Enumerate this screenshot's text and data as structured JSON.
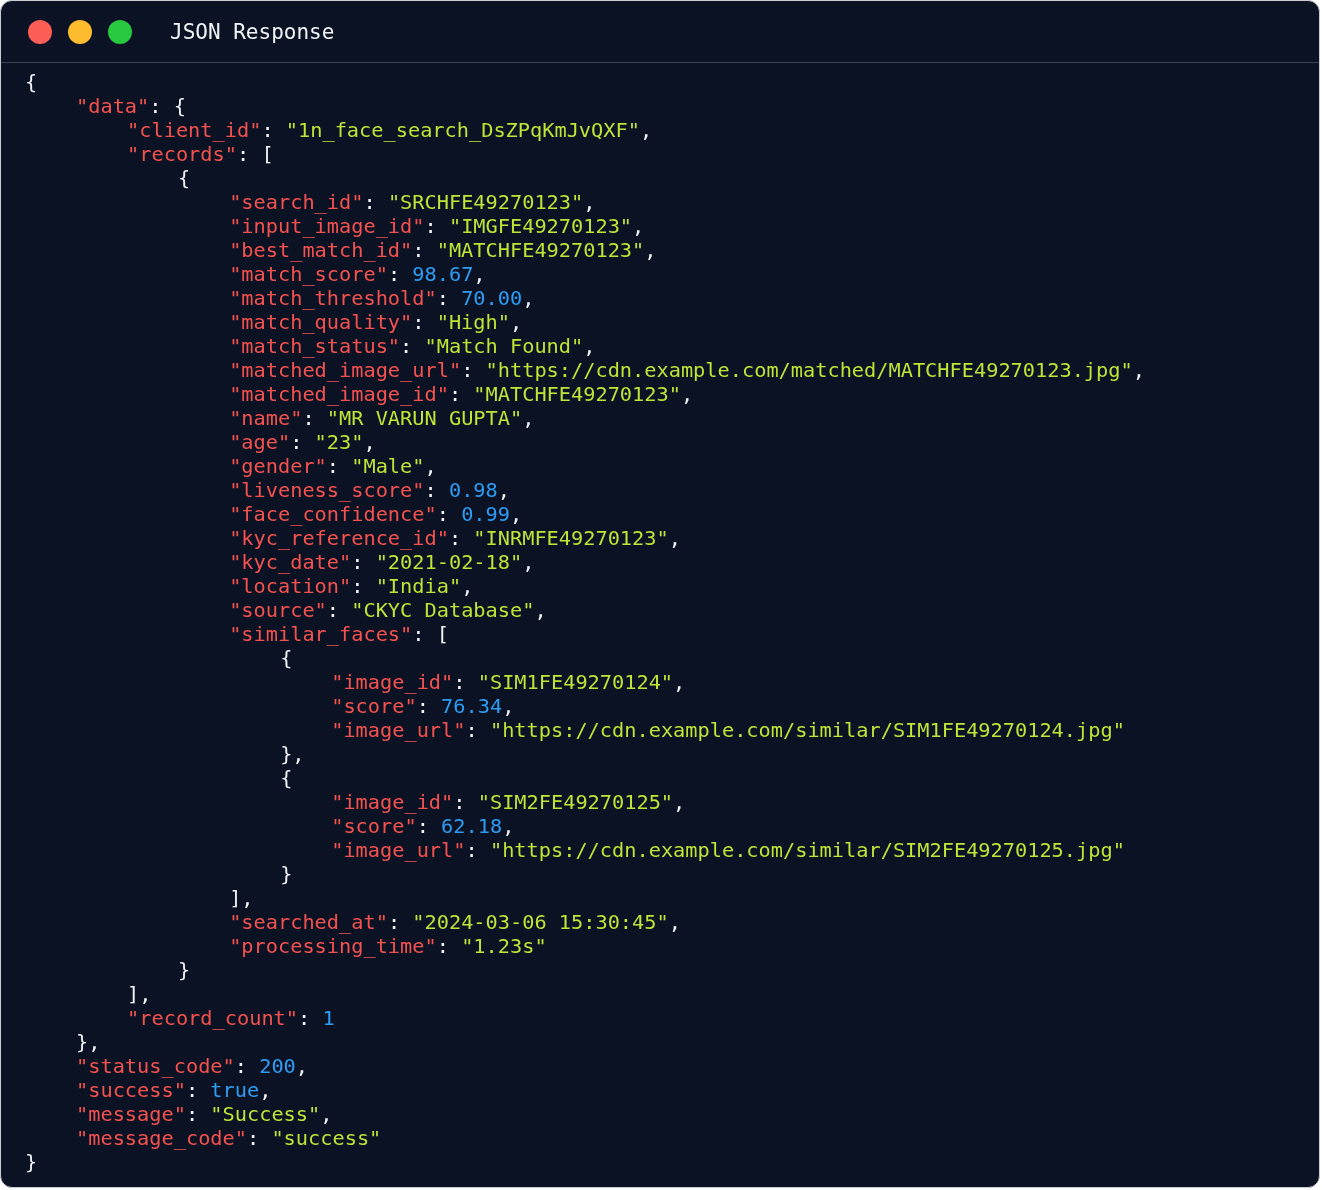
{
  "window": {
    "title": "JSON Response"
  },
  "code": [
    {
      "tokens": [
        {
          "kind": "punct",
          "text": "{"
        }
      ],
      "children": [
        {
          "tokens": [
            {
              "kind": "key",
              "text": "\"data\""
            },
            {
              "kind": "punct",
              "text": ": {"
            }
          ],
          "children": [
            {
              "tokens": [
                {
                  "kind": "key",
                  "text": "\"client_id\""
                },
                {
                  "kind": "punct",
                  "text": ": "
                },
                {
                  "kind": "string",
                  "text": "\"1n_face_search_DsZPqKmJvQXF\""
                },
                {
                  "kind": "punct",
                  "text": ","
                }
              ]
            },
            {
              "tokens": [
                {
                  "kind": "key",
                  "text": "\"records\""
                },
                {
                  "kind": "punct",
                  "text": ": ["
                }
              ],
              "children": [
                {
                  "tokens": [
                    {
                      "kind": "punct",
                      "text": "{"
                    }
                  ],
                  "children": [
                    {
                      "tokens": [
                        {
                          "kind": "key",
                          "text": "\"search_id\""
                        },
                        {
                          "kind": "punct",
                          "text": ": "
                        },
                        {
                          "kind": "string",
                          "text": "\"SRCHFE49270123\""
                        },
                        {
                          "kind": "punct",
                          "text": ","
                        }
                      ]
                    },
                    {
                      "tokens": [
                        {
                          "kind": "key",
                          "text": "\"input_image_id\""
                        },
                        {
                          "kind": "punct",
                          "text": ": "
                        },
                        {
                          "kind": "string",
                          "text": "\"IMGFE49270123\""
                        },
                        {
                          "kind": "punct",
                          "text": ","
                        }
                      ]
                    },
                    {
                      "tokens": [
                        {
                          "kind": "key",
                          "text": "\"best_match_id\""
                        },
                        {
                          "kind": "punct",
                          "text": ": "
                        },
                        {
                          "kind": "string",
                          "text": "\"MATCHFE49270123\""
                        },
                        {
                          "kind": "punct",
                          "text": ","
                        }
                      ]
                    },
                    {
                      "tokens": [
                        {
                          "kind": "key",
                          "text": "\"match_score\""
                        },
                        {
                          "kind": "punct",
                          "text": ": "
                        },
                        {
                          "kind": "number",
                          "text": "98.67"
                        },
                        {
                          "kind": "punct",
                          "text": ","
                        }
                      ]
                    },
                    {
                      "tokens": [
                        {
                          "kind": "key",
                          "text": "\"match_threshold\""
                        },
                        {
                          "kind": "punct",
                          "text": ": "
                        },
                        {
                          "kind": "number",
                          "text": "70.00"
                        },
                        {
                          "kind": "punct",
                          "text": ","
                        }
                      ]
                    },
                    {
                      "tokens": [
                        {
                          "kind": "key",
                          "text": "\"match_quality\""
                        },
                        {
                          "kind": "punct",
                          "text": ": "
                        },
                        {
                          "kind": "string",
                          "text": "\"High\""
                        },
                        {
                          "kind": "punct",
                          "text": ","
                        }
                      ]
                    },
                    {
                      "tokens": [
                        {
                          "kind": "key",
                          "text": "\"match_status\""
                        },
                        {
                          "kind": "punct",
                          "text": ": "
                        },
                        {
                          "kind": "string",
                          "text": "\"Match Found\""
                        },
                        {
                          "kind": "punct",
                          "text": ","
                        }
                      ]
                    },
                    {
                      "tokens": [
                        {
                          "kind": "key",
                          "text": "\"matched_image_url\""
                        },
                        {
                          "kind": "punct",
                          "text": ": "
                        },
                        {
                          "kind": "string",
                          "text": "\"https://cdn.example.com/matched/MATCHFE49270123.jpg\""
                        },
                        {
                          "kind": "punct",
                          "text": ","
                        }
                      ]
                    },
                    {
                      "tokens": [
                        {
                          "kind": "key",
                          "text": "\"matched_image_id\""
                        },
                        {
                          "kind": "punct",
                          "text": ": "
                        },
                        {
                          "kind": "string",
                          "text": "\"MATCHFE49270123\""
                        },
                        {
                          "kind": "punct",
                          "text": ","
                        }
                      ]
                    },
                    {
                      "tokens": [
                        {
                          "kind": "key",
                          "text": "\"name\""
                        },
                        {
                          "kind": "punct",
                          "text": ": "
                        },
                        {
                          "kind": "string",
                          "text": "\"MR VARUN GUPTA\""
                        },
                        {
                          "kind": "punct",
                          "text": ","
                        }
                      ]
                    },
                    {
                      "tokens": [
                        {
                          "kind": "key",
                          "text": "\"age\""
                        },
                        {
                          "kind": "punct",
                          "text": ": "
                        },
                        {
                          "kind": "string",
                          "text": "\"23\""
                        },
                        {
                          "kind": "punct",
                          "text": ","
                        }
                      ]
                    },
                    {
                      "tokens": [
                        {
                          "kind": "key",
                          "text": "\"gender\""
                        },
                        {
                          "kind": "punct",
                          "text": ": "
                        },
                        {
                          "kind": "string",
                          "text": "\"Male\""
                        },
                        {
                          "kind": "punct",
                          "text": ","
                        }
                      ]
                    },
                    {
                      "tokens": [
                        {
                          "kind": "key",
                          "text": "\"liveness_score\""
                        },
                        {
                          "kind": "punct",
                          "text": ": "
                        },
                        {
                          "kind": "number",
                          "text": "0.98"
                        },
                        {
                          "kind": "punct",
                          "text": ","
                        }
                      ]
                    },
                    {
                      "tokens": [
                        {
                          "kind": "key",
                          "text": "\"face_confidence\""
                        },
                        {
                          "kind": "punct",
                          "text": ": "
                        },
                        {
                          "kind": "number",
                          "text": "0.99"
                        },
                        {
                          "kind": "punct",
                          "text": ","
                        }
                      ]
                    },
                    {
                      "tokens": [
                        {
                          "kind": "key",
                          "text": "\"kyc_reference_id\""
                        },
                        {
                          "kind": "punct",
                          "text": ": "
                        },
                        {
                          "kind": "string",
                          "text": "\"INRMFE49270123\""
                        },
                        {
                          "kind": "punct",
                          "text": ","
                        }
                      ]
                    },
                    {
                      "tokens": [
                        {
                          "kind": "key",
                          "text": "\"kyc_date\""
                        },
                        {
                          "kind": "punct",
                          "text": ": "
                        },
                        {
                          "kind": "string",
                          "text": "\"2021-02-18\""
                        },
                        {
                          "kind": "punct",
                          "text": ","
                        }
                      ]
                    },
                    {
                      "tokens": [
                        {
                          "kind": "key",
                          "text": "\"location\""
                        },
                        {
                          "kind": "punct",
                          "text": ": "
                        },
                        {
                          "kind": "string",
                          "text": "\"India\""
                        },
                        {
                          "kind": "punct",
                          "text": ","
                        }
                      ]
                    },
                    {
                      "tokens": [
                        {
                          "kind": "key",
                          "text": "\"source\""
                        },
                        {
                          "kind": "punct",
                          "text": ": "
                        },
                        {
                          "kind": "string",
                          "text": "\"CKYC Database\""
                        },
                        {
                          "kind": "punct",
                          "text": ","
                        }
                      ]
                    },
                    {
                      "tokens": [
                        {
                          "kind": "key",
                          "text": "\"similar_faces\""
                        },
                        {
                          "kind": "punct",
                          "text": ": ["
                        }
                      ],
                      "children": [
                        {
                          "tokens": [
                            {
                              "kind": "punct",
                              "text": "{"
                            }
                          ],
                          "children": [
                            {
                              "tokens": [
                                {
                                  "kind": "key",
                                  "text": "\"image_id\""
                                },
                                {
                                  "kind": "punct",
                                  "text": ": "
                                },
                                {
                                  "kind": "string",
                                  "text": "\"SIM1FE49270124\""
                                },
                                {
                                  "kind": "punct",
                                  "text": ","
                                }
                              ]
                            },
                            {
                              "tokens": [
                                {
                                  "kind": "key",
                                  "text": "\"score\""
                                },
                                {
                                  "kind": "punct",
                                  "text": ": "
                                },
                                {
                                  "kind": "number",
                                  "text": "76.34"
                                },
                                {
                                  "kind": "punct",
                                  "text": ","
                                }
                              ]
                            },
                            {
                              "tokens": [
                                {
                                  "kind": "key",
                                  "text": "\"image_url\""
                                },
                                {
                                  "kind": "punct",
                                  "text": ": "
                                },
                                {
                                  "kind": "string",
                                  "text": "\"https://cdn.example.com/similar/SIM1FE49270124.jpg\""
                                }
                              ]
                            }
                          ]
                        },
                        {
                          "tokens": [
                            {
                              "kind": "punct",
                              "text": "},"
                            }
                          ]
                        },
                        {
                          "tokens": [
                            {
                              "kind": "punct",
                              "text": "{"
                            }
                          ],
                          "children": [
                            {
                              "tokens": [
                                {
                                  "kind": "key",
                                  "text": "\"image_id\""
                                },
                                {
                                  "kind": "punct",
                                  "text": ": "
                                },
                                {
                                  "kind": "string",
                                  "text": "\"SIM2FE49270125\""
                                },
                                {
                                  "kind": "punct",
                                  "text": ","
                                }
                              ]
                            },
                            {
                              "tokens": [
                                {
                                  "kind": "key",
                                  "text": "\"score\""
                                },
                                {
                                  "kind": "punct",
                                  "text": ": "
                                },
                                {
                                  "kind": "number",
                                  "text": "62.18"
                                },
                                {
                                  "kind": "punct",
                                  "text": ","
                                }
                              ]
                            },
                            {
                              "tokens": [
                                {
                                  "kind": "key",
                                  "text": "\"image_url\""
                                },
                                {
                                  "kind": "punct",
                                  "text": ": "
                                },
                                {
                                  "kind": "string",
                                  "text": "\"https://cdn.example.com/similar/SIM2FE49270125.jpg\""
                                }
                              ]
                            }
                          ]
                        },
                        {
                          "tokens": [
                            {
                              "kind": "punct",
                              "text": "}"
                            }
                          ]
                        }
                      ]
                    },
                    {
                      "tokens": [
                        {
                          "kind": "punct",
                          "text": "],"
                        }
                      ]
                    },
                    {
                      "tokens": [
                        {
                          "kind": "key",
                          "text": "\"searched_at\""
                        },
                        {
                          "kind": "punct",
                          "text": ": "
                        },
                        {
                          "kind": "string",
                          "text": "\"2024-03-06 15:30:45\""
                        },
                        {
                          "kind": "punct",
                          "text": ","
                        }
                      ]
                    },
                    {
                      "tokens": [
                        {
                          "kind": "key",
                          "text": "\"processing_time\""
                        },
                        {
                          "kind": "punct",
                          "text": ": "
                        },
                        {
                          "kind": "string",
                          "text": "\"1.23s\""
                        }
                      ]
                    }
                  ]
                },
                {
                  "tokens": [
                    {
                      "kind": "punct",
                      "text": "}"
                    }
                  ]
                }
              ]
            },
            {
              "tokens": [
                {
                  "kind": "punct",
                  "text": "],"
                }
              ]
            },
            {
              "tokens": [
                {
                  "kind": "key",
                  "text": "\"record_count\""
                },
                {
                  "kind": "punct",
                  "text": ": "
                },
                {
                  "kind": "number",
                  "text": "1"
                }
              ]
            }
          ]
        },
        {
          "tokens": [
            {
              "kind": "punct",
              "text": "},"
            }
          ]
        },
        {
          "tokens": [
            {
              "kind": "key",
              "text": "\"status_code\""
            },
            {
              "kind": "punct",
              "text": ": "
            },
            {
              "kind": "number",
              "text": "200"
            },
            {
              "kind": "punct",
              "text": ","
            }
          ]
        },
        {
          "tokens": [
            {
              "kind": "key",
              "text": "\"success\""
            },
            {
              "kind": "punct",
              "text": ": "
            },
            {
              "kind": "boolean",
              "text": "true"
            },
            {
              "kind": "punct",
              "text": ","
            }
          ]
        },
        {
          "tokens": [
            {
              "kind": "key",
              "text": "\"message\""
            },
            {
              "kind": "punct",
              "text": ": "
            },
            {
              "kind": "string",
              "text": "\"Success\""
            },
            {
              "kind": "punct",
              "text": ","
            }
          ]
        },
        {
          "tokens": [
            {
              "kind": "key",
              "text": "\"message_code\""
            },
            {
              "kind": "punct",
              "text": ": "
            },
            {
              "kind": "string",
              "text": "\"success\""
            }
          ]
        }
      ]
    },
    {
      "tokens": [
        {
          "kind": "punct",
          "text": "}"
        }
      ]
    }
  ]
}
